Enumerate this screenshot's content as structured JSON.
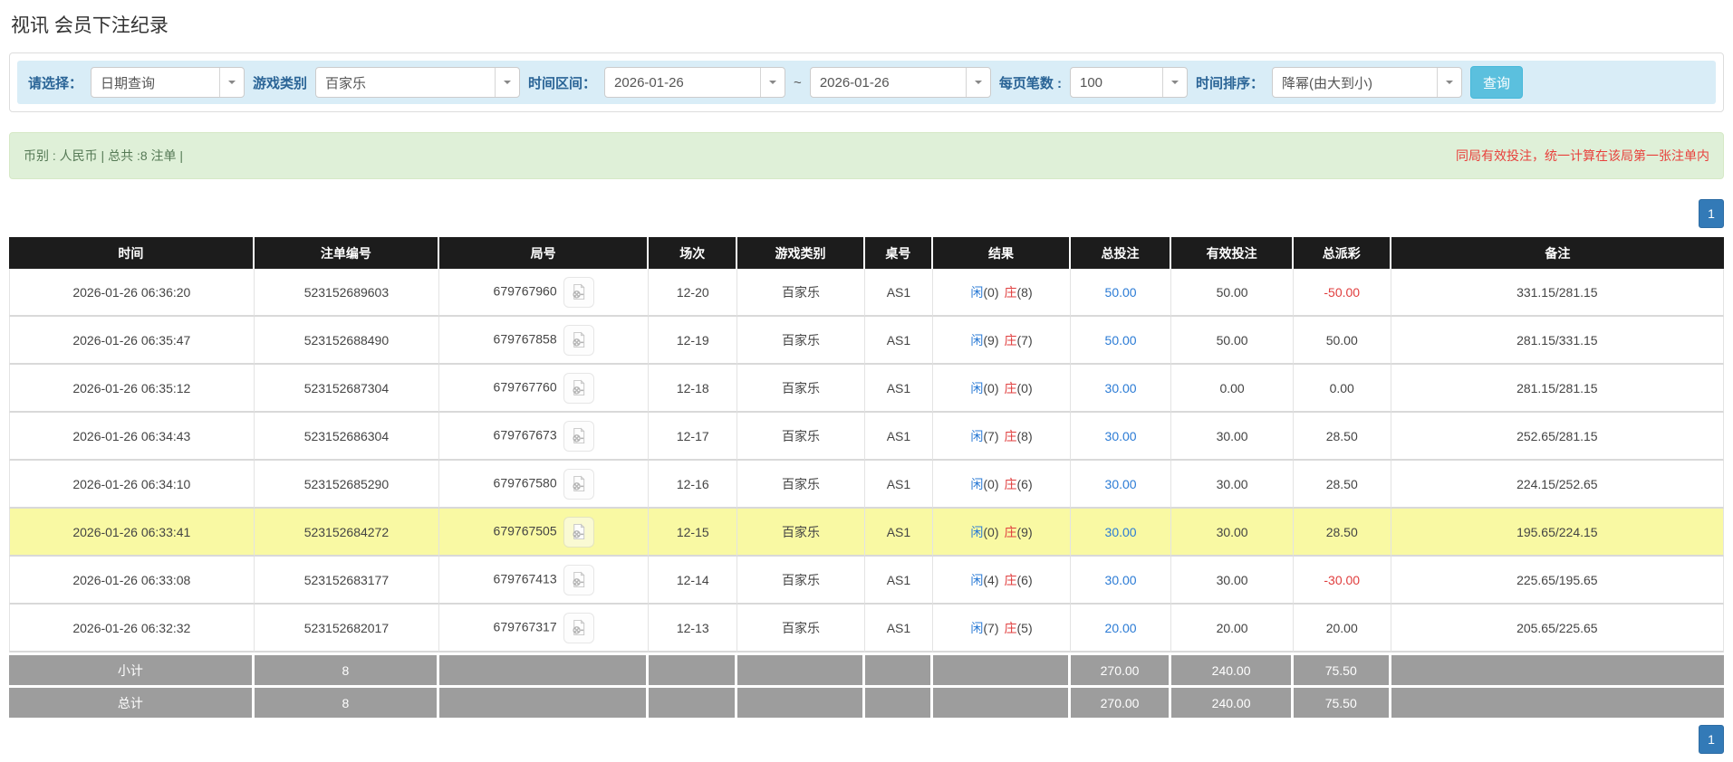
{
  "title": "视讯 会员下注纪录",
  "filter": {
    "select_label": "请选择：",
    "select_value": "日期查询",
    "game_label": "游戏类别",
    "game_value": "百家乐",
    "range_label": "时间区间：",
    "date_from": "2026-01-26",
    "tilde": "~",
    "date_to": "2026-01-26",
    "per_page_label": "每页笔数 :",
    "per_page_value": "100",
    "sort_label": "时间排序：",
    "sort_value": "降幂(由大到小)",
    "query_button": "查询"
  },
  "notice": {
    "left": "币别 : 人民币 | 总共 :8 注单 |",
    "right": "同局有效投注，统一计算在该局第一张注单内"
  },
  "pagination": {
    "page": "1"
  },
  "table": {
    "headers": [
      "时间",
      "注单编号",
      "局号",
      "场次",
      "游戏类别",
      "桌号",
      "结果",
      "总投注",
      "有效投注",
      "总派彩",
      "备注"
    ],
    "rows": [
      {
        "time": "2026-01-26 06:36:20",
        "bet_no": "523152689603",
        "round_no": "679767960",
        "session": "12-20",
        "game": "百家乐",
        "table_no": "AS1",
        "player_label": "闲",
        "player_score": "(0)",
        "banker_label": "庄",
        "banker_score": "(8)",
        "total_bet": "50.00",
        "valid_bet": "50.00",
        "payout": "-50.00",
        "remark": "331.15/281.15",
        "highlight": false
      },
      {
        "time": "2026-01-26 06:35:47",
        "bet_no": "523152688490",
        "round_no": "679767858",
        "session": "12-19",
        "game": "百家乐",
        "table_no": "AS1",
        "player_label": "闲",
        "player_score": "(9)",
        "banker_label": "庄",
        "banker_score": "(7)",
        "total_bet": "50.00",
        "valid_bet": "50.00",
        "payout": "50.00",
        "remark": "281.15/331.15",
        "highlight": false
      },
      {
        "time": "2026-01-26 06:35:12",
        "bet_no": "523152687304",
        "round_no": "679767760",
        "session": "12-18",
        "game": "百家乐",
        "table_no": "AS1",
        "player_label": "闲",
        "player_score": "(0)",
        "banker_label": "庄",
        "banker_score": "(0)",
        "total_bet": "30.00",
        "valid_bet": "0.00",
        "payout": "0.00",
        "remark": "281.15/281.15",
        "highlight": false
      },
      {
        "time": "2026-01-26 06:34:43",
        "bet_no": "523152686304",
        "round_no": "679767673",
        "session": "12-17",
        "game": "百家乐",
        "table_no": "AS1",
        "player_label": "闲",
        "player_score": "(7)",
        "banker_label": "庄",
        "banker_score": "(8)",
        "total_bet": "30.00",
        "valid_bet": "30.00",
        "payout": "28.50",
        "remark": "252.65/281.15",
        "highlight": false
      },
      {
        "time": "2026-01-26 06:34:10",
        "bet_no": "523152685290",
        "round_no": "679767580",
        "session": "12-16",
        "game": "百家乐",
        "table_no": "AS1",
        "player_label": "闲",
        "player_score": "(0)",
        "banker_label": "庄",
        "banker_score": "(6)",
        "total_bet": "30.00",
        "valid_bet": "30.00",
        "payout": "28.50",
        "remark": "224.15/252.65",
        "highlight": false
      },
      {
        "time": "2026-01-26 06:33:41",
        "bet_no": "523152684272",
        "round_no": "679767505",
        "session": "12-15",
        "game": "百家乐",
        "table_no": "AS1",
        "player_label": "闲",
        "player_score": "(0)",
        "banker_label": "庄",
        "banker_score": "(9)",
        "total_bet": "30.00",
        "valid_bet": "30.00",
        "payout": "28.50",
        "remark": "195.65/224.15",
        "highlight": true
      },
      {
        "time": "2026-01-26 06:33:08",
        "bet_no": "523152683177",
        "round_no": "679767413",
        "session": "12-14",
        "game": "百家乐",
        "table_no": "AS1",
        "player_label": "闲",
        "player_score": "(4)",
        "banker_label": "庄",
        "banker_score": "(6)",
        "total_bet": "30.00",
        "valid_bet": "30.00",
        "payout": "-30.00",
        "remark": "225.65/195.65",
        "highlight": false
      },
      {
        "time": "2026-01-26 06:32:32",
        "bet_no": "523152682017",
        "round_no": "679767317",
        "session": "12-13",
        "game": "百家乐",
        "table_no": "AS1",
        "player_label": "闲",
        "player_score": "(7)",
        "banker_label": "庄",
        "banker_score": "(5)",
        "total_bet": "20.00",
        "valid_bet": "20.00",
        "payout": "20.00",
        "remark": "205.65/225.65",
        "highlight": false
      }
    ],
    "subtotal": {
      "label": "小计",
      "count": "8",
      "total_bet": "270.00",
      "valid_bet": "240.00",
      "payout": "75.50"
    },
    "total": {
      "label": "总计",
      "count": "8",
      "total_bet": "270.00",
      "valid_bet": "240.00",
      "payout": "75.50"
    }
  },
  "icons": {
    "video_replay": "film-document-icon",
    "dropdown": "chevron-down-icon"
  },
  "colors": {
    "accent_blue": "#2b7bd5",
    "result_red": "#e03e3e",
    "highlight_yellow": "#f9f9a3",
    "header_bg": "#1c1c1c",
    "footer_bg": "#9d9d9d",
    "filter_bg": "#d9edf7",
    "notice_bg": "#dff0d8",
    "notice_red": "#e8413c",
    "query_button_blue": "#5bc0de",
    "pager_blue": "#337ab7"
  }
}
